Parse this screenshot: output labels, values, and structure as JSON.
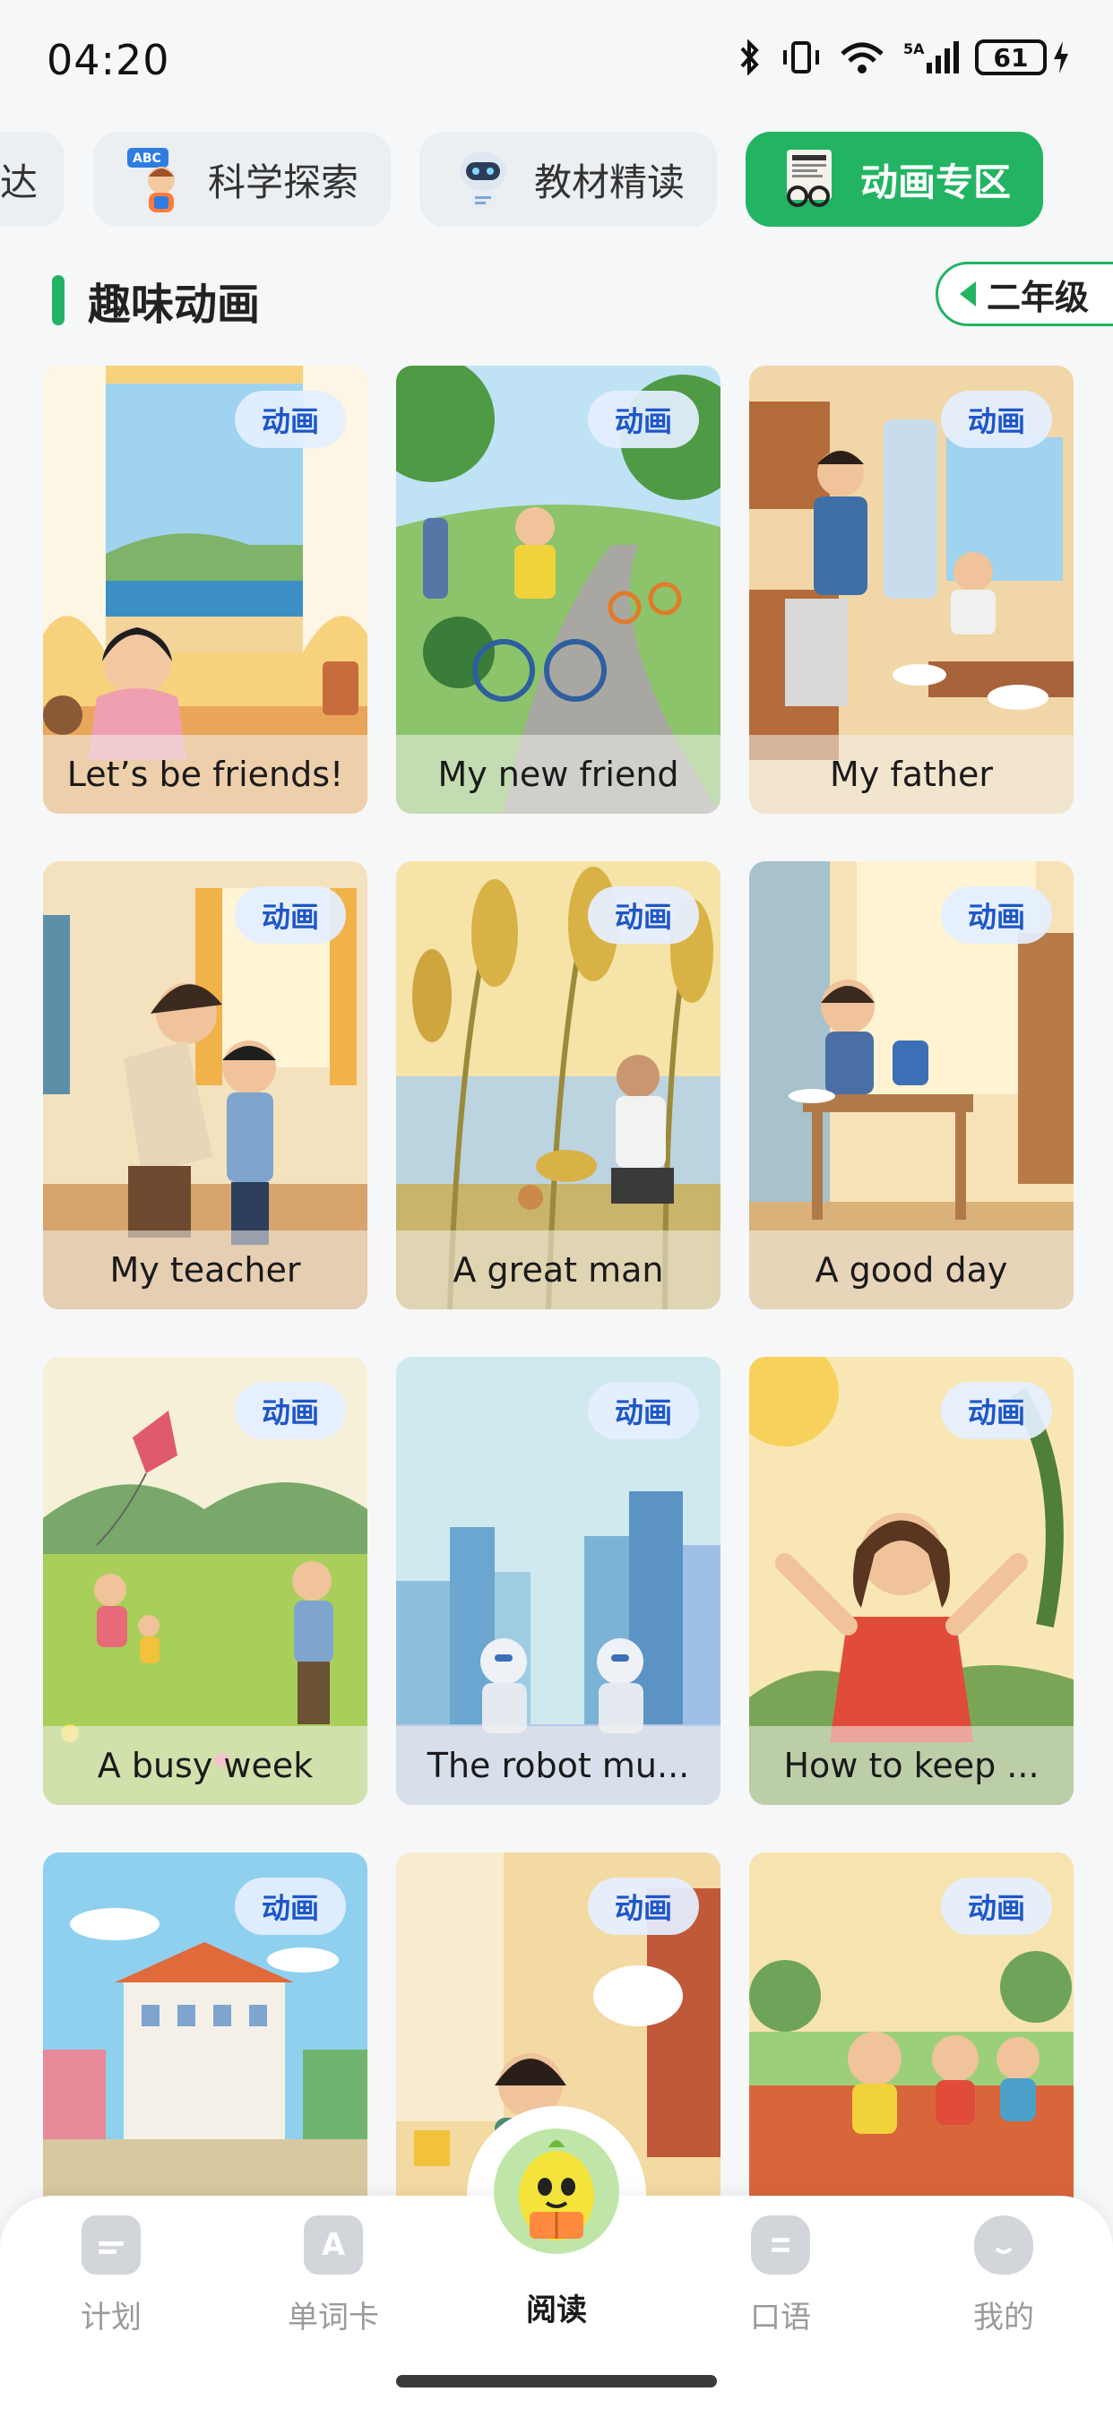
{
  "status_bar": {
    "time": "04:20",
    "battery": "61"
  },
  "tabs": [
    {
      "label": "达",
      "icon": ""
    },
    {
      "label": "科学探索",
      "icon": "abc-kid-icon"
    },
    {
      "label": "教材精读",
      "icon": "robot-icon"
    },
    {
      "label": "动画专区",
      "icon": "newspaper-glasses-icon",
      "active": true
    }
  ],
  "section": {
    "title": "趣味动画",
    "grade": "二年级"
  },
  "cards": [
    {
      "tag": "动画",
      "title": "Let’s be friends!"
    },
    {
      "tag": "动画",
      "title": "My new friend"
    },
    {
      "tag": "动画",
      "title": "My father"
    },
    {
      "tag": "动画",
      "title": "My teacher"
    },
    {
      "tag": "动画",
      "title": "A great man"
    },
    {
      "tag": "动画",
      "title": "A good day"
    },
    {
      "tag": "动画",
      "title": "A busy week"
    },
    {
      "tag": "动画",
      "title": "The robot mu..."
    },
    {
      "tag": "动画",
      "title": "How to keep ..."
    },
    {
      "tag": "动画",
      "title": ""
    },
    {
      "tag": "动画",
      "title": ""
    },
    {
      "tag": "动画",
      "title": ""
    }
  ],
  "nav": [
    {
      "label": "计划",
      "icon": "plan-icon"
    },
    {
      "label": "单词卡",
      "icon": "word-card-icon"
    },
    {
      "label": "阅读",
      "icon": "reading-mascot-icon",
      "active": true
    },
    {
      "label": "口语",
      "icon": "speaking-icon"
    },
    {
      "label": "我的",
      "icon": "profile-icon"
    }
  ],
  "colors": {
    "accent": "#22b463",
    "tag_text": "#1e56c8"
  }
}
